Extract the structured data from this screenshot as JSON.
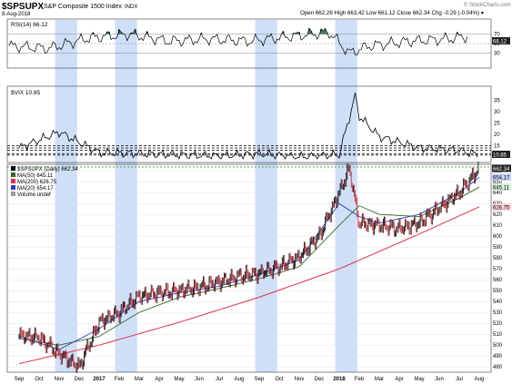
{
  "header": {
    "symbol": "$SPSUPX",
    "description": "S&P Composite 1500 Index",
    "exchange": "INDX",
    "date": "8-Aug-2018",
    "ohlc": "Open 662.26  High 663.42  Low 661.12  Close 662.34  Chg -0.29 (-0.04%) ▾",
    "watermark": "© StockCharts.com"
  },
  "panels": {
    "rsi": {
      "label": "RSI(14) 66.12",
      "current_tag": "66.12",
      "levels": [
        70,
        50,
        30
      ]
    },
    "vix": {
      "label": "$VIX 10.85",
      "current_tag": "10.85",
      "yticks": [
        35,
        30,
        25,
        20,
        15
      ]
    },
    "price": {
      "legend": [
        {
          "text": "$SPSUPX (Daily) 662.34",
          "color": "#000000"
        },
        {
          "text": "MA(50) 645.11",
          "color": "#2e6b2e"
        },
        {
          "text": "MA(200) 626.75",
          "color": "#e0304a"
        },
        {
          "text": "MA(20) 654.17",
          "color": "#2a3cc7"
        },
        {
          "text": "Volume undef",
          "color": "#999999"
        }
      ],
      "tags": [
        {
          "text": "662.34",
          "value": 662.34,
          "bg": "#222222",
          "fg": "#ffffff"
        },
        {
          "text": "654.17",
          "value": 654.17,
          "bg": "#c9d2ff",
          "fg": "#000000"
        },
        {
          "text": "645.11",
          "value": 645.11,
          "bg": "#d6eed6",
          "fg": "#000000"
        },
        {
          "text": "626.75",
          "value": 626.75,
          "bg": "#ffd3da",
          "fg": "#000000"
        }
      ]
    }
  },
  "colors": {
    "highlight": "#c6d9f7",
    "up": "#000000",
    "down": "#c0202a",
    "ma50": "#2e6b2e",
    "ma200": "#e0304a",
    "ma20": "#2a3cc7",
    "rsi_fill": "#2f6b4f"
  },
  "chart_data": {
    "type": "line",
    "title": "$SPSUPX S&P Composite 1500 Index INDX",
    "x_axis_labels": [
      "Sep",
      "Oct",
      "Nov",
      "Dec",
      "2017",
      "Feb",
      "Mar",
      "Apr",
      "May",
      "Jun",
      "Jul",
      "Aug",
      "Sep",
      "Oct",
      "Nov",
      "Dec",
      "2018",
      "Feb",
      "Mar",
      "Apr",
      "May",
      "Jun",
      "Jul",
      "Aug"
    ],
    "price_axis": {
      "ticks": [
        480,
        490,
        500,
        510,
        520,
        530,
        540,
        550,
        560,
        570,
        580,
        590,
        600,
        610,
        620,
        630,
        640,
        650,
        660
      ],
      "ylim": [
        476,
        666
      ]
    },
    "highlight_spans": [
      [
        "Nov 2016",
        "Dec 2016"
      ],
      [
        "Feb 2017",
        "Mar 2017"
      ],
      [
        "Sep 2017",
        "Oct 2017"
      ],
      [
        "Jan 2018",
        "Feb 2018"
      ]
    ],
    "green_reference_line": 662.34,
    "series": [
      {
        "name": "$SPSUPX (Daily)",
        "x": [
          0,
          1,
          2,
          3,
          4,
          5,
          6,
          7,
          8,
          9,
          10,
          11,
          12,
          13,
          14,
          15,
          16,
          16.5,
          17,
          18,
          19,
          20,
          21,
          22,
          23
        ],
        "values": [
          509,
          507,
          492,
          480,
          521,
          530,
          545,
          548,
          550,
          553,
          558,
          563,
          566,
          572,
          581,
          600,
          640,
          662,
          612,
          610,
          607,
          612,
          626,
          640,
          662
        ]
      },
      {
        "name": "MA(50)",
        "x": [
          0,
          2,
          4,
          6,
          8,
          10,
          12,
          14,
          16,
          17,
          18,
          20,
          22,
          23
        ],
        "values": [
          506,
          500,
          508,
          530,
          544,
          552,
          561,
          572,
          610,
          628,
          620,
          618,
          635,
          645
        ]
      },
      {
        "name": "MA(200)",
        "x": [
          0,
          4,
          8,
          12,
          16,
          20,
          23
        ],
        "values": [
          483,
          500,
          521,
          544,
          570,
          602,
          627
        ]
      },
      {
        "name": "MA(20)",
        "x": [
          0,
          2,
          4,
          6,
          8,
          10,
          12,
          14,
          16,
          17,
          18,
          20,
          22,
          23
        ],
        "values": [
          508,
          496,
          515,
          540,
          548,
          554,
          565,
          578,
          630,
          618,
          612,
          620,
          640,
          654
        ]
      },
      {
        "name": "RSI(14)",
        "x": [
          0,
          2,
          4,
          6,
          8,
          10,
          12,
          14,
          16,
          17,
          18,
          20,
          22,
          23
        ],
        "values": [
          45,
          40,
          62,
          70,
          55,
          60,
          55,
          65,
          74,
          30,
          45,
          55,
          60,
          66.12
        ]
      },
      {
        "name": "$VIX",
        "x": [
          0,
          2,
          4,
          6,
          8,
          10,
          12,
          14,
          16,
          16.8,
          17,
          18,
          20,
          22,
          23
        ],
        "values": [
          14,
          21,
          12,
          11.5,
          11,
          10.5,
          11.5,
          10,
          11,
          37,
          28,
          19,
          14,
          13,
          10.85
        ]
      }
    ]
  }
}
